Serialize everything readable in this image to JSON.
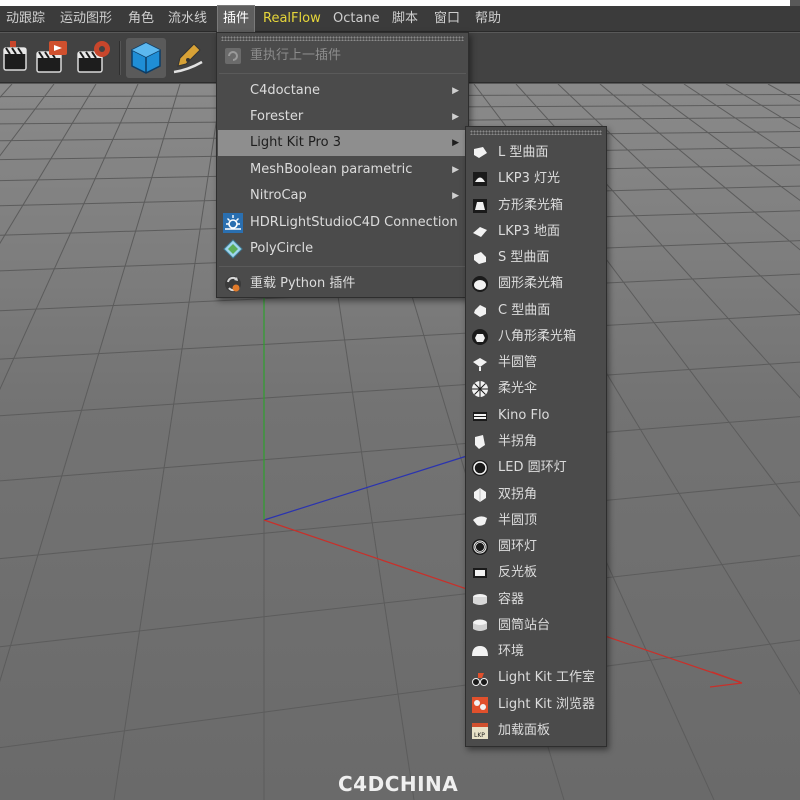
{
  "menubar": {
    "items": [
      {
        "label": "动跟踪"
      },
      {
        "label": "运动图形"
      },
      {
        "label": "角色"
      },
      {
        "label": "流水线"
      },
      {
        "label": "插件"
      },
      {
        "label": "RealFlow"
      },
      {
        "label": "Octane"
      },
      {
        "label": "脚本"
      },
      {
        "label": "窗口"
      },
      {
        "label": "帮助"
      }
    ],
    "active_index": 4
  },
  "plugins_menu": {
    "repeat_last": "重执行上一插件",
    "items": [
      {
        "label": "C4doctane",
        "has_submenu": true
      },
      {
        "label": "Forester",
        "has_submenu": true
      },
      {
        "label": "Light Kit Pro 3",
        "has_submenu": true,
        "highlighted": true
      },
      {
        "label": "MeshBoolean parametric",
        "has_submenu": true
      },
      {
        "label": "NitroCap",
        "has_submenu": true
      },
      {
        "label": "HDRLightStudioC4D Connection",
        "icon": "sun-icon"
      },
      {
        "label": "PolyCircle",
        "icon": "polycircle-icon"
      }
    ],
    "reload": "重载 Python 插件"
  },
  "lightkit_submenu": {
    "items": [
      {
        "label": "L 型曲面",
        "icon": "l-curve-icon"
      },
      {
        "label": "LKP3 灯光",
        "icon": "lkp3-light-icon"
      },
      {
        "label": "方形柔光箱",
        "icon": "square-softbox-icon"
      },
      {
        "label": "LKP3 地面",
        "icon": "lkp3-ground-icon"
      },
      {
        "label": "S 型曲面",
        "icon": "s-curve-icon"
      },
      {
        "label": "圆形柔光箱",
        "icon": "round-softbox-icon"
      },
      {
        "label": "C 型曲面",
        "icon": "c-curve-icon"
      },
      {
        "label": "八角形柔光箱",
        "icon": "octagon-softbox-icon"
      },
      {
        "label": "半圆管",
        "icon": "half-pipe-icon"
      },
      {
        "label": "柔光伞",
        "icon": "umbrella-icon"
      },
      {
        "label": "Kino Flo",
        "icon": "kino-flo-icon"
      },
      {
        "label": "半拐角",
        "icon": "half-corner-icon"
      },
      {
        "label": "LED 圆环灯",
        "icon": "led-ring-icon"
      },
      {
        "label": "双拐角",
        "icon": "double-corner-icon"
      },
      {
        "label": "半圆顶",
        "icon": "half-dome-icon"
      },
      {
        "label": "圆环灯",
        "icon": "ring-light-icon"
      },
      {
        "label": "反光板",
        "icon": "reflector-icon"
      },
      {
        "label": "容器",
        "icon": "container-icon"
      },
      {
        "label": "圆筒站台",
        "icon": "cylinder-stage-icon"
      },
      {
        "label": "环境",
        "icon": "environment-icon"
      },
      {
        "label": "Light Kit 工作室",
        "icon": "studio-icon"
      },
      {
        "label": "Light Kit 浏览器",
        "icon": "browser-icon"
      },
      {
        "label": "加载面板",
        "icon": "load-panel-icon"
      }
    ]
  },
  "watermark": "C4DCHINA",
  "colors": {
    "menubar_bg": "#3b3b3b",
    "menu_bg": "#4b4b4b",
    "highlight_bg": "#8e8e8e",
    "realflow_accent": "#e6d63a",
    "viewport_bg": "#6f6f6f",
    "axis_x": "#c8302a",
    "axis_y": "#2ea02e",
    "axis_z": "#2a33b0"
  }
}
